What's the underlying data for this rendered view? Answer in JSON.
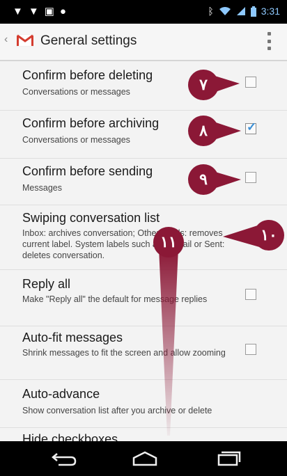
{
  "status_bar": {
    "time": "3:31",
    "icons_left": [
      "sync-icon",
      "sync-icon",
      "gallery-icon",
      "messenger-icon"
    ],
    "icons_right": [
      "bluetooth-icon",
      "wifi-icon",
      "signal-icon",
      "battery-icon"
    ]
  },
  "action_bar": {
    "title": "General settings",
    "app_icon": "gmail-icon",
    "overflow_icon": "overflow-menu-icon"
  },
  "settings": [
    {
      "title": "Confirm before deleting",
      "summary": "Conversations or messages",
      "checkbox": true,
      "checked": false
    },
    {
      "title": "Confirm before archiving",
      "summary": "Conversations or messages",
      "checkbox": true,
      "checked": true
    },
    {
      "title": "Confirm before sending",
      "summary": "Messages",
      "checkbox": true,
      "checked": false
    },
    {
      "title": "Swiping conversation list",
      "summary": "Inbox: archives conversation; Other labels: removes current label. System labels such as All mail or Sent: deletes conversation.",
      "checkbox": false,
      "checked": false
    },
    {
      "title": "Reply all",
      "summary": "Make \"Reply all\" the default for message replies",
      "checkbox": true,
      "checked": false
    },
    {
      "title": "Auto-fit messages",
      "summary": "Shrink messages to fit the screen and allow zooming",
      "checkbox": true,
      "checked": false
    },
    {
      "title": "Auto-advance",
      "summary": "Show conversation list after you archive or delete",
      "checkbox": false,
      "checked": false
    },
    {
      "title": "Hide checkboxes",
      "summary": "",
      "checkbox": false,
      "checked": false
    }
  ],
  "annotations": [
    {
      "label": "٧"
    },
    {
      "label": "٨"
    },
    {
      "label": "٩"
    },
    {
      "label": "١٠"
    },
    {
      "label": "١١"
    }
  ],
  "nav_bar": {
    "buttons": [
      "back-icon",
      "home-icon",
      "recent-apps-icon"
    ]
  },
  "colors": {
    "annotation": "#8b1836",
    "checkbox_tick": "#3a8fd6",
    "gmail_red": "#d43c2f"
  }
}
